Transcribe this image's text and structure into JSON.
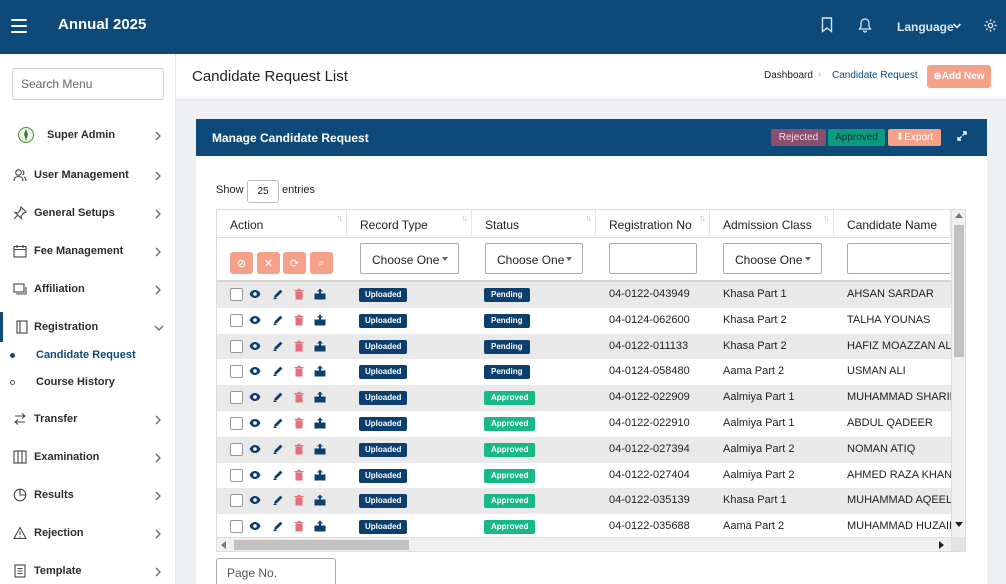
{
  "header": {
    "title": "Annual 2025",
    "language_label": "Language"
  },
  "sidebar": {
    "search_placeholder": "Search Menu",
    "items": [
      {
        "label": "Super Admin"
      },
      {
        "label": "User Management"
      },
      {
        "label": "General Setups"
      },
      {
        "label": "Fee Management"
      },
      {
        "label": "Affiliation"
      },
      {
        "label": "Registration"
      },
      {
        "label": "Transfer"
      },
      {
        "label": "Examination"
      },
      {
        "label": "Results"
      },
      {
        "label": "Rejection"
      },
      {
        "label": "Template"
      }
    ],
    "subitems": [
      {
        "label": "Candidate Request"
      },
      {
        "label": "Course History"
      }
    ]
  },
  "page": {
    "title": "Candidate Request List",
    "breadcrumb": [
      "Dashboard",
      "Candidate Request"
    ],
    "add_new_label": "Add New"
  },
  "card": {
    "title": "Manage Candidate Request",
    "rejected_label": "Rejected",
    "approved_label": "Approved",
    "export_label": "Export"
  },
  "table_controls": {
    "show_label": "Show",
    "entries_value": "25",
    "entries_label": "entries",
    "page_placeholder": "Page No."
  },
  "table": {
    "columns": [
      "Action",
      "Record Type",
      "Status",
      "Registration No",
      "Admission Class",
      "Candidate Name"
    ],
    "filter_placeholder": "Choose One",
    "rows": [
      {
        "record_type": "Uploaded",
        "status": "Pending",
        "reg_no": "04-0122-043949",
        "class": "Khasa Part 1",
        "name": "AHSAN SARDAR"
      },
      {
        "record_type": "Uploaded",
        "status": "Pending",
        "reg_no": "04-0124-062600",
        "class": "Khasa Part 2",
        "name": "TALHA YOUNAS"
      },
      {
        "record_type": "Uploaded",
        "status": "Pending",
        "reg_no": "04-0122-011133",
        "class": "Khasa Part 2",
        "name": "HAFIZ MOAZZAN ALI"
      },
      {
        "record_type": "Uploaded",
        "status": "Pending",
        "reg_no": "04-0124-058480",
        "class": "Aama Part 2",
        "name": "USMAN ALI"
      },
      {
        "record_type": "Uploaded",
        "status": "Approved",
        "reg_no": "04-0122-022909",
        "class": "Aalmiya Part 1",
        "name": "MUHAMMAD SHARIF"
      },
      {
        "record_type": "Uploaded",
        "status": "Approved",
        "reg_no": "04-0122-022910",
        "class": "Aalmiya Part 1",
        "name": "ABDUL QADEER"
      },
      {
        "record_type": "Uploaded",
        "status": "Approved",
        "reg_no": "04-0122-027394",
        "class": "Aalmiya Part 2",
        "name": "NOMAN ATIQ"
      },
      {
        "record_type": "Uploaded",
        "status": "Approved",
        "reg_no": "04-0122-027404",
        "class": "Aalmiya Part 2",
        "name": "AHMED RAZA KHAN"
      },
      {
        "record_type": "Uploaded",
        "status": "Approved",
        "reg_no": "04-0122-035139",
        "class": "Khasa Part 1",
        "name": "MUHAMMAD AQEEL"
      },
      {
        "record_type": "Uploaded",
        "status": "Approved",
        "reg_no": "04-0122-035688",
        "class": "Aama Part 2",
        "name": "MUHAMMAD HUZAIFA"
      }
    ]
  },
  "colors": {
    "brand": "#0d4a7a",
    "accent": "#f5a088",
    "pending": "#0d3f6e",
    "approved": "#18b889",
    "delete": "#e2727a"
  },
  "icons": [
    "menu-icon",
    "bookmark-icon",
    "bell-icon",
    "chevron-down-icon",
    "gear-icon",
    "expand-icon",
    "eye-icon",
    "pencil-icon",
    "trash-icon",
    "upload-icon"
  ]
}
